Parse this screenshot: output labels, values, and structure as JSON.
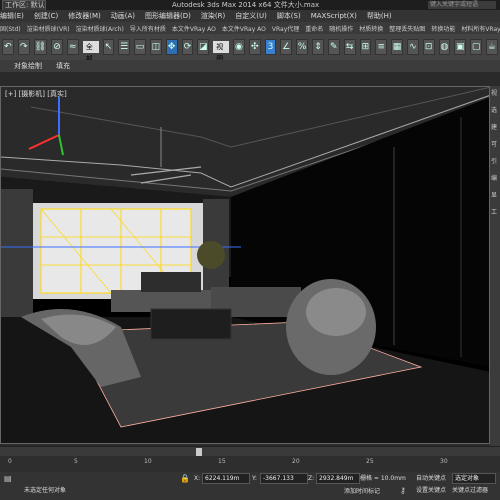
{
  "title_bar": {
    "workspace": "工作区: 默认",
    "app_title": "Autodesk 3ds Max  2014 x64      文件大小.max",
    "search_placeholder": "键入关键字或短语"
  },
  "menu": [
    "编辑(E)",
    "创建(C)",
    "修改器(M)",
    "动画(A)",
    "图形编辑器(D)",
    "渲染(R)",
    "自定义(U)",
    "脚本(S)",
    "MAXScript(X)",
    "帮助(H)"
  ],
  "toolbar1": [
    "固(Std)",
    "渲染材质球(VR)",
    "渲染材质球(Arch)",
    "导入所有材质",
    "本文件VRay AO",
    "本文件VRay AO",
    "VRay代理",
    "重命名",
    "随机操作",
    "材质转换",
    "整理丢失贴图",
    "转换功能",
    "材料所有VRayHt"
  ],
  "toolbar2": {
    "selection_filter": "全部",
    "view_dropdown": "视图"
  },
  "ribbon": [
    "对象绘制",
    "填充"
  ],
  "viewport": {
    "label": "[+] [摄影机] [真实]"
  },
  "command_panel": [
    "视",
    "选",
    "建",
    "可",
    "引",
    "编",
    "显",
    "工"
  ],
  "time_slider": {
    "ticks": [
      "0",
      "5",
      "10",
      "15",
      "20",
      "25",
      "30"
    ]
  },
  "status": {
    "x_label": "X:",
    "x_value": "6224.119m",
    "y_label": "Y:",
    "y_value": "-3667.133",
    "z_label": "Z:",
    "z_value": "2932.849m",
    "grid": "栅格 = 10.0mm",
    "add_time_tag": "添加时间标记",
    "auto_key": "自动关键点",
    "set_key": "设置关键点",
    "selected_object": "选定对象",
    "key_filter": "关键点过滤器",
    "selection_count": "未选定任何对象"
  },
  "colors": {
    "accent_blue": "#2e6fb3",
    "viewport_bg": "#000000",
    "selection_yellow": "#ffd800"
  }
}
